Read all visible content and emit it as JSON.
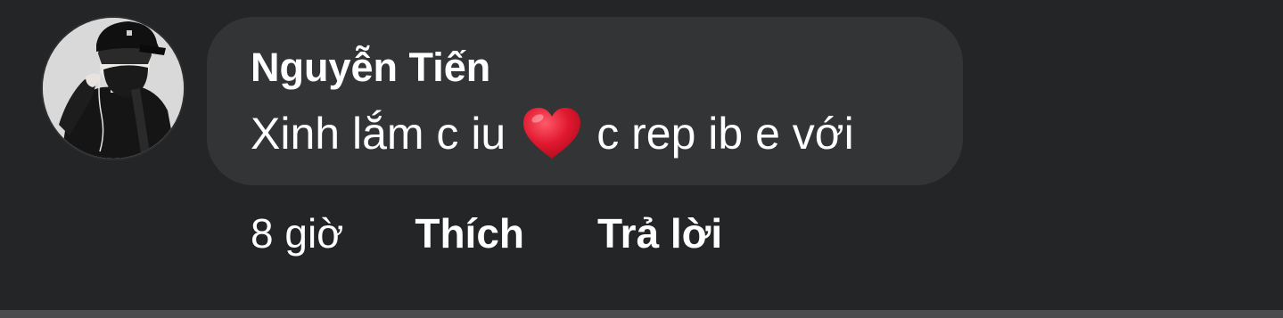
{
  "comment": {
    "author": "Nguyễn Tiến",
    "text_before_emoji": "Xinh lắm c iu",
    "emoji": "red-heart-icon",
    "text_after_emoji": "c rep ib e với",
    "time": "8 giờ",
    "like_label": "Thích",
    "reply_label": "Trả lời"
  },
  "colors": {
    "background": "#242527",
    "bubble": "#333436",
    "text": "#ffffff",
    "heart": "#e0182f"
  }
}
